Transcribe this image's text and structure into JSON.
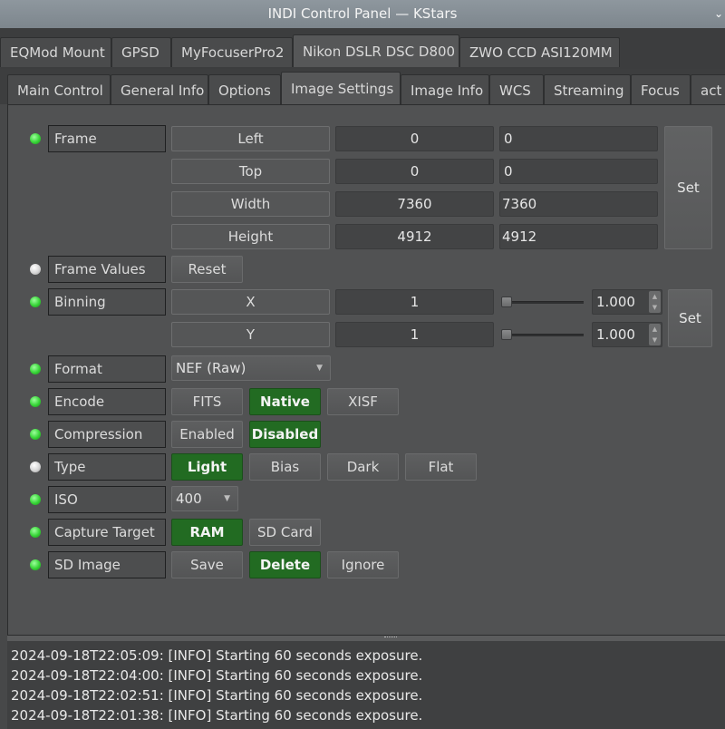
{
  "window": {
    "title": "INDI Control Panel — KStars"
  },
  "device_tabs": [
    {
      "label": "EQMod Mount",
      "mnemonic": "E",
      "active": false
    },
    {
      "label": "GPSD",
      "mnemonic": "G",
      "active": false
    },
    {
      "label": "MyFocuserPro2",
      "mnemonic": "y",
      "active": false
    },
    {
      "label": "Nikon DSLR DSC D800",
      "mnemonic": "N",
      "active": true
    },
    {
      "label": "ZWO CCD ASI120MM",
      "mnemonic": "Z",
      "active": false
    }
  ],
  "group_tabs": [
    {
      "label": "Main Control",
      "active": false
    },
    {
      "label": "General Info",
      "active": false
    },
    {
      "label": "Options",
      "active": false
    },
    {
      "label": "Image Settings",
      "active": true
    },
    {
      "label": "Image Info",
      "active": false
    },
    {
      "label": "WCS",
      "active": false
    },
    {
      "label": "Streaming",
      "active": false
    },
    {
      "label": "Focus",
      "active": false
    },
    {
      "label": "act",
      "active": false
    }
  ],
  "properties": {
    "frame": {
      "label": "Frame",
      "state": "ok",
      "elements": [
        {
          "name": "Left",
          "value": "0",
          "target": "0"
        },
        {
          "name": "Top",
          "value": "0",
          "target": "0"
        },
        {
          "name": "Width",
          "value": "7360",
          "target": "7360"
        },
        {
          "name": "Height",
          "value": "4912",
          "target": "4912"
        }
      ],
      "set_label": "Set"
    },
    "frame_values": {
      "label": "Frame Values",
      "state": "idle",
      "button": "Reset"
    },
    "binning": {
      "label": "Binning",
      "state": "ok",
      "elements": [
        {
          "name": "X",
          "value": "1",
          "spin": "1.000",
          "slider_fraction": 0
        },
        {
          "name": "Y",
          "value": "1",
          "spin": "1.000",
          "slider_fraction": 0
        }
      ],
      "set_label": "Set"
    },
    "format": {
      "label": "Format",
      "state": "ok",
      "selected": "NEF (Raw)"
    },
    "encode": {
      "label": "Encode",
      "state": "ok",
      "options": [
        "FITS",
        "Native",
        "XISF"
      ],
      "selected": "Native"
    },
    "compression": {
      "label": "Compression",
      "state": "ok",
      "options": [
        "Enabled",
        "Disabled"
      ],
      "selected": "Disabled"
    },
    "type": {
      "label": "Type",
      "state": "idle",
      "options": [
        "Light",
        "Bias",
        "Dark",
        "Flat"
      ],
      "selected": "Light"
    },
    "iso": {
      "label": "ISO",
      "state": "ok",
      "selected": "400"
    },
    "capture_target": {
      "label": "Capture Target",
      "state": "ok",
      "options": [
        "RAM",
        "SD Card"
      ],
      "selected": "RAM"
    },
    "sd_image": {
      "label": "SD Image",
      "state": "ok",
      "options": [
        "Save",
        "Delete",
        "Ignore"
      ],
      "selected": "Delete"
    }
  },
  "log": [
    "2024-09-18T22:05:09: [INFO] Starting 60 seconds exposure.",
    "2024-09-18T22:04:00: [INFO] Starting 60 seconds exposure.",
    "2024-09-18T22:02:51: [INFO] Starting 60 seconds exposure.",
    "2024-09-18T22:01:38: [INFO] Starting 60 seconds exposure."
  ],
  "colors": {
    "ok_led": "#36d436",
    "idle_led": "#d5d5d5",
    "active_button": "#226b22"
  }
}
